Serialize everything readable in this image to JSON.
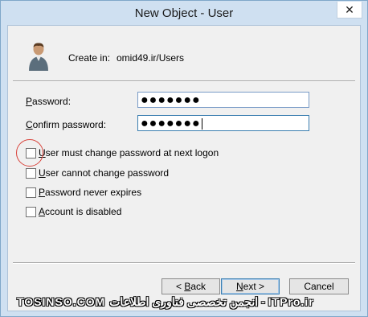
{
  "window": {
    "title": "New Object - User",
    "close_glyph": "✕"
  },
  "header": {
    "create_in_label": "Create in:",
    "create_in_value": "omid49.ir/Users",
    "icon": "user-icon"
  },
  "password": {
    "label_prefix": "",
    "label_accel": "P",
    "label_rest": "assword:",
    "value": "●●●●●●●"
  },
  "confirm": {
    "label_prefix": "",
    "label_accel": "C",
    "label_rest": "onfirm password:",
    "value": "●●●●●●●"
  },
  "options": [
    {
      "accel": "U",
      "rest": "ser must change password at next logon",
      "checked": false
    },
    {
      "accel": "U",
      "rest": "ser cannot change password",
      "checked": false
    },
    {
      "accel": "P",
      "rest": "assword never expires",
      "checked": false
    },
    {
      "accel": "A",
      "rest": "ccount is disabled",
      "checked": false
    }
  ],
  "buttons": {
    "back_prefix": "< ",
    "back_accel": "B",
    "back_rest": "ack",
    "next_accel": "N",
    "next_rest": "ext >",
    "cancel": "Cancel"
  },
  "watermark": "TOSINSO.COM انجمن تخصصی فناوری اطلاعات - ITPro.ir"
}
